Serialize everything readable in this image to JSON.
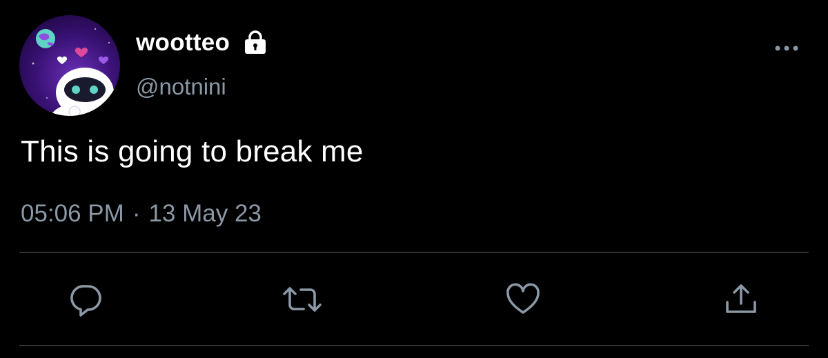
{
  "tweet": {
    "display_name": "wootteo",
    "handle": "@notnini",
    "protected_icon": "lock-icon",
    "text": "This is going to break me",
    "time": "05:06 PM",
    "separator": "·",
    "date": "13 May 23"
  },
  "avatar": {
    "description_icon": "avatar-robot-space",
    "colors": {
      "background": "#2a0a52",
      "accent_purple": "#8c4fe0",
      "heart_pink": "#e0489b",
      "planet": "#5fd3c5"
    }
  },
  "actions": [
    {
      "name": "reply",
      "icon": "speech-bubble-icon"
    },
    {
      "name": "retweet",
      "icon": "retweet-arrows-icon"
    },
    {
      "name": "like",
      "icon": "heart-icon"
    },
    {
      "name": "share",
      "icon": "share-upload-icon"
    }
  ],
  "colors": {
    "background": "#000000",
    "primary_text": "#ffffff",
    "secondary_text": "#8b98a5",
    "divider": "#2f3336"
  }
}
